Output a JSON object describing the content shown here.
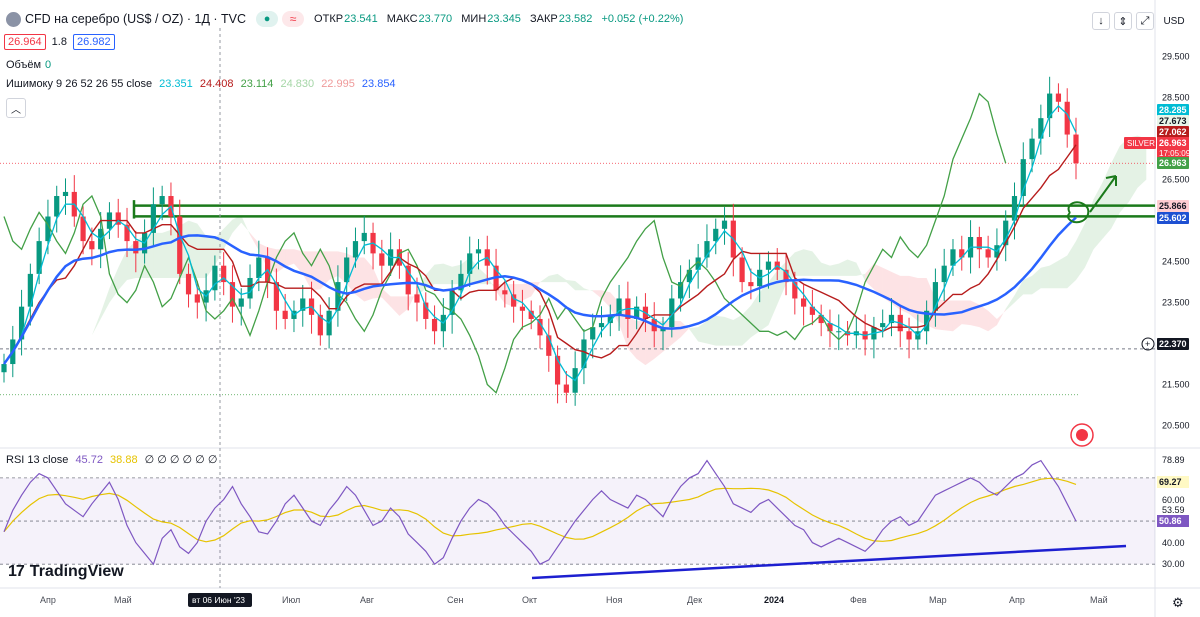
{
  "header": {
    "title": "CFD на серебро (US$ / OZ) · 1Д · TVC",
    "ohlc": [
      {
        "label": "ОТКР",
        "value": "23.541"
      },
      {
        "label": "МАКС",
        "value": "23.770"
      },
      {
        "label": "МИН",
        "value": "23.345"
      },
      {
        "label": "ЗАКР",
        "value": "23.582"
      },
      {
        "label": "",
        "value": "+0.052 (+0.22%)"
      }
    ],
    "sell_price": "26.964",
    "spread": "1.8",
    "buy_price": "26.982",
    "currency": "USD"
  },
  "legends": {
    "volume": {
      "label": "Объём",
      "value": "0"
    },
    "ichimoku": {
      "label": "Ишимоку 9 26 52 26 55 close",
      "values": [
        "23.351",
        "24.408",
        "23.114",
        "24.830",
        "22.995",
        "23.854"
      ],
      "colors": [
        "#00bcd4",
        "#b71c1c",
        "#43a047",
        "#a5d6a7",
        "#ef9a9a",
        "#2962ff"
      ]
    },
    "rsi": {
      "label": "RSI 13 close",
      "values": [
        "45.72",
        "38.88",
        "∅ ∅ ∅ ∅ ∅ ∅"
      ],
      "colors": [
        "#7e57c2",
        "#e6c300",
        "#131722"
      ]
    }
  },
  "chart_data": [
    {
      "type": "candlestick",
      "title": "",
      "price_scale": {
        "ticks": [
          "29.500",
          "28.500",
          "26.500",
          "24.500",
          "23.500",
          "21.500",
          "20.500"
        ],
        "ylim": [
          20.0,
          30.2
        ]
      },
      "time_scale": {
        "ticks": [
          "Апр",
          "Май",
          "Июл",
          "Авг",
          "Сен",
          "Окт",
          "Ноя",
          "Дек",
          "2024",
          "Фев",
          "Мар",
          "Апр",
          "Май"
        ],
        "crosshair_label": "вт 06 Июн '23"
      },
      "close_path": [
        22.0,
        22.6,
        23.4,
        24.2,
        25.0,
        25.6,
        26.1,
        26.2,
        25.6,
        25.0,
        24.8,
        25.3,
        25.7,
        25.4,
        25.0,
        24.7,
        25.2,
        25.9,
        26.1,
        25.6,
        24.2,
        23.7,
        23.5,
        23.8,
        24.4,
        24.0,
        23.4,
        23.6,
        24.1,
        24.6,
        24.0,
        23.3,
        23.1,
        23.3,
        23.6,
        23.2,
        22.7,
        23.3,
        24.0,
        24.6,
        25.0,
        25.2,
        24.7,
        24.4,
        24.8,
        24.4,
        23.7,
        23.5,
        23.1,
        22.8,
        23.2,
        23.8,
        24.2,
        24.7,
        24.8,
        24.4,
        23.8,
        23.7,
        23.4,
        23.3,
        23.1,
        22.7,
        22.2,
        21.5,
        21.3,
        21.9,
        22.6,
        22.9,
        23.0,
        23.2,
        23.6,
        23.1,
        23.4,
        23.1,
        22.8,
        22.9,
        23.6,
        24.0,
        24.3,
        24.6,
        25.0,
        25.3,
        25.5,
        24.6,
        24.0,
        23.9,
        24.3,
        24.5,
        24.3,
        24.0,
        23.6,
        23.4,
        23.2,
        23.0,
        22.8,
        22.8,
        22.7,
        22.8,
        22.6,
        22.9,
        23.0,
        23.2,
        22.8,
        22.6,
        22.8,
        23.3,
        24.0,
        24.4,
        24.8,
        24.6,
        25.1,
        24.8,
        24.6,
        24.9,
        25.5,
        26.1,
        27.0,
        27.5,
        28.0,
        28.6,
        28.4,
        27.6,
        26.9
      ],
      "horizontal_lines": [
        {
          "value": "25.866"
        },
        {
          "value": "25.602"
        },
        {
          "value": "22.370"
        }
      ],
      "price_labels": [
        {
          "value": "28.285",
          "color": "#00bcd4"
        },
        {
          "value": "27.673",
          "color": "#e8f5e9"
        },
        {
          "value": "27.062",
          "color": "#b71c1c"
        },
        {
          "value": "26.963",
          "color": "#f23645",
          "symbol": "SILVER",
          "countdown": "17:05:09"
        },
        {
          "value": "26.963",
          "color": "#43a047"
        },
        {
          "value": "25.866",
          "color": "#ffcdd2"
        },
        {
          "value": "25.602",
          "color": "#1e50d2"
        },
        {
          "value": "22.370",
          "color": "#131722"
        }
      ]
    },
    {
      "type": "line",
      "title": "",
      "series": [
        {
          "values": [
            45,
            55,
            62,
            68,
            72,
            70,
            64,
            58,
            55,
            52,
            58,
            63,
            68,
            60,
            48,
            40,
            35,
            30,
            42,
            46,
            38,
            35,
            40,
            50,
            56,
            60,
            66,
            58,
            52,
            45,
            44,
            50,
            58,
            62,
            56,
            50,
            48,
            55,
            60,
            66,
            62,
            55,
            48,
            50,
            56,
            52,
            44,
            40,
            36,
            30,
            33,
            42,
            50,
            56,
            60,
            58,
            54,
            48,
            44,
            40,
            36,
            30,
            32,
            38,
            44,
            50,
            55,
            60,
            64,
            60,
            58,
            56,
            62,
            60,
            56,
            52,
            60,
            66,
            70,
            72,
            78,
            72,
            66,
            58,
            56,
            54,
            58,
            60,
            56,
            52,
            48,
            46,
            40,
            38,
            40,
            42,
            40,
            38,
            36,
            40,
            46,
            50,
            52,
            48,
            50,
            56,
            62,
            64,
            66,
            68,
            70,
            68,
            64,
            62,
            66,
            70,
            72,
            76,
            78,
            72,
            66,
            58,
            50
          ]
        }
      ],
      "ylim": [
        25,
        82
      ],
      "ticks": [
        "78.89",
        "69.27",
        "60.00",
        "53.59",
        "50.86",
        "40.00",
        "30.00"
      ],
      "levels": [
        70,
        50,
        30
      ]
    }
  ]
}
